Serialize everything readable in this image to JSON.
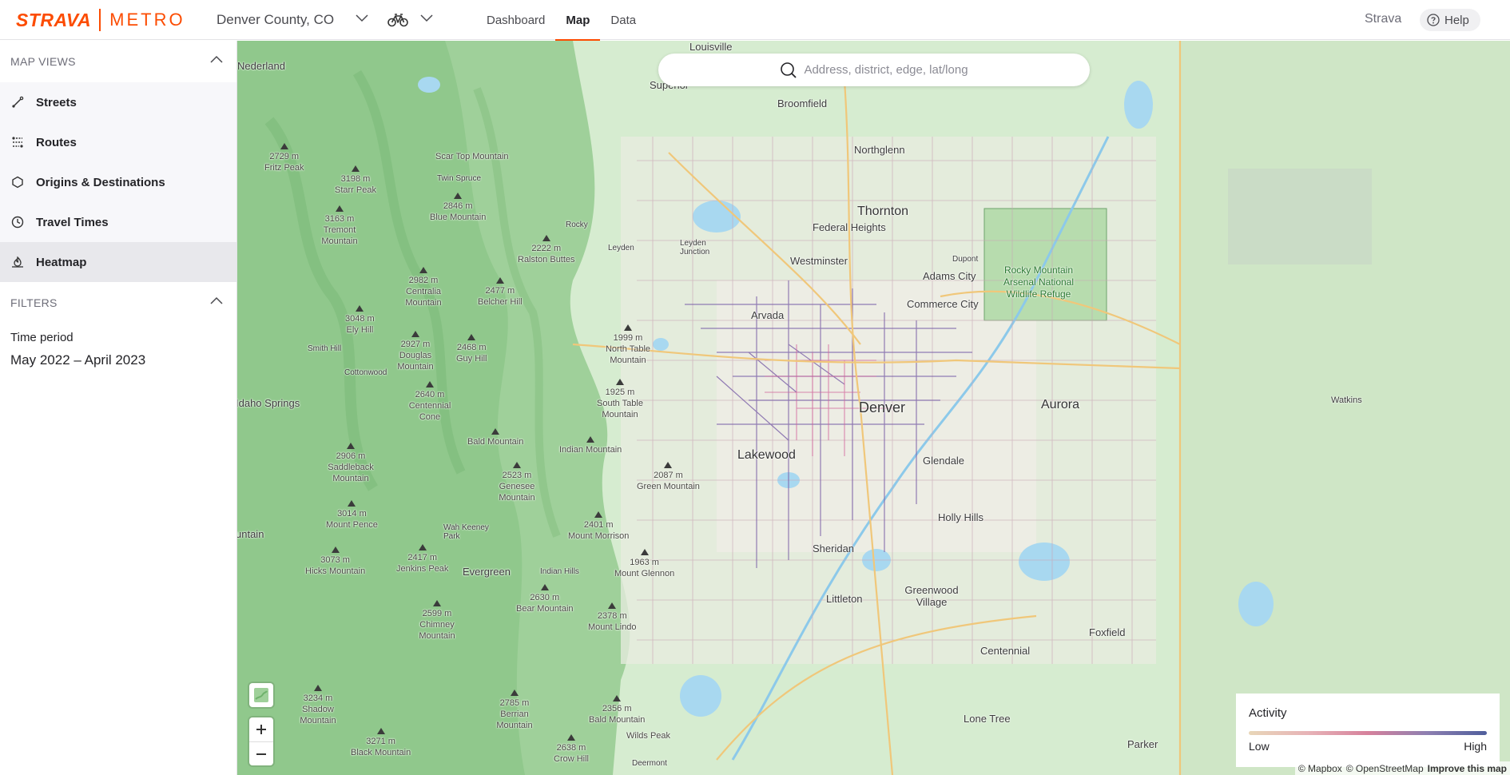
{
  "header": {
    "logo_brand": "STRAVA",
    "logo_product": "METRO",
    "region": "Denver County, CO",
    "sport_icon": "bicycle-icon",
    "tabs": [
      {
        "label": "Dashboard",
        "active": false
      },
      {
        "label": "Map",
        "active": true
      },
      {
        "label": "Data",
        "active": false
      }
    ],
    "strava_link": "Strava",
    "help_label": "Help"
  },
  "sidebar": {
    "map_views_heading": "MAP VIEWS",
    "views": [
      {
        "label": "Streets",
        "icon": "streets-icon",
        "active": false
      },
      {
        "label": "Routes",
        "icon": "routes-icon",
        "active": false
      },
      {
        "label": "Origins & Destinations",
        "icon": "hexagon-icon",
        "active": false
      },
      {
        "label": "Travel Times",
        "icon": "clock-icon",
        "active": false
      },
      {
        "label": "Heatmap",
        "icon": "heatmap-icon",
        "active": true
      }
    ],
    "filters_heading": "FILTERS",
    "time_period_label": "Time period",
    "time_period_value": "May 2022 – April 2023"
  },
  "map": {
    "search_placeholder": "Address, district, edge, lat/long",
    "places": {
      "louisville": "Louisville",
      "superior": "Superior",
      "broomfield": "Broomfield",
      "northglenn": "Northglenn",
      "thornton": "Thornton",
      "federal_heights": "Federal Heights",
      "westminster": "Westminster",
      "dupont": "Dupont",
      "adams_city": "Adams City",
      "commerce_city": "Commerce City",
      "arvada": "Arvada",
      "denver": "Denver",
      "aurora": "Aurora",
      "watkins": "Watkins",
      "lakewood": "Lakewood",
      "glendale": "Glendale",
      "holly_hills": "Holly Hills",
      "sheridan": "Sheridan",
      "greenwood_village": "Greenwood Village",
      "littleton": "Littleton",
      "foxfield": "Foxfield",
      "centennial": "Centennial",
      "lone_tree": "Lone Tree",
      "parker": "Parker",
      "evergreen": "Evergreen",
      "idaho_springs": "Idaho Springs",
      "nederland": "Nederland",
      "rocky": "Rocky",
      "leyden": "Leyden",
      "leyden_junction": "Leyden Junction",
      "twin_spruce": "Twin Spruce",
      "smith_hill": "Smith Hill",
      "cottonwood": "Cottonwood",
      "wah_keeney_park": "Wah Keeney Park",
      "indian_hills": "Indian Hills",
      "deermont": "Deermont",
      "untain": "untain",
      "rocky_mountain_arsenal": "Rocky Mountain Arsenal National Wildlife Refuge"
    },
    "peaks": [
      {
        "elev": "2729 m",
        "name": "Fritz Peak"
      },
      {
        "elev": "3198 m",
        "name": "Starr Peak"
      },
      {
        "elev": "",
        "name": "Scar Top Mountain"
      },
      {
        "elev": "2846 m",
        "name": "Blue Mountain"
      },
      {
        "elev": "3163 m",
        "name": "Tremont Mountain"
      },
      {
        "elev": "2222 m",
        "name": "Ralston Buttes"
      },
      {
        "elev": "2982 m",
        "name": "Centralia Mountain"
      },
      {
        "elev": "2477 m",
        "name": "Belcher Hill"
      },
      {
        "elev": "3048 m",
        "name": "Ely Hill"
      },
      {
        "elev": "1999 m",
        "name": "North Table Mountain"
      },
      {
        "elev": "2927 m",
        "name": "Douglas Mountain"
      },
      {
        "elev": "2468 m",
        "name": "Guy Hill"
      },
      {
        "elev": "1925 m",
        "name": "South Table Mountain"
      },
      {
        "elev": "2640 m",
        "name": "Centennial Cone"
      },
      {
        "elev": "",
        "name": "Bald Mountain"
      },
      {
        "elev": "",
        "name": "Indian Mountain"
      },
      {
        "elev": "2906 m",
        "name": "Saddleback Mountain"
      },
      {
        "elev": "2523 m",
        "name": "Genesee Mountain"
      },
      {
        "elev": "2087 m",
        "name": "Green Mountain"
      },
      {
        "elev": "3014 m",
        "name": "Mount Pence"
      },
      {
        "elev": "2401 m",
        "name": "Mount Morrison"
      },
      {
        "elev": "3073 m",
        "name": "Hicks Mountain"
      },
      {
        "elev": "2417 m",
        "name": "Jenkins Peak"
      },
      {
        "elev": "1963 m",
        "name": "Mount Glennon"
      },
      {
        "elev": "2630 m",
        "name": "Bear Mountain"
      },
      {
        "elev": "2599 m",
        "name": "Chimney Mountain"
      },
      {
        "elev": "2378 m",
        "name": "Mount Lindo"
      },
      {
        "elev": "3234 m",
        "name": "Shadow Mountain"
      },
      {
        "elev": "2785 m",
        "name": "Berrian Mountain"
      },
      {
        "elev": "2356 m",
        "name": "Bald Mountain"
      },
      {
        "elev": "3271 m",
        "name": "Black Mountain"
      },
      {
        "elev": "2638 m",
        "name": "Crow Hill"
      },
      {
        "elev": "",
        "name": "Wilds Peak"
      }
    ],
    "legend": {
      "title": "Activity",
      "low": "Low",
      "high": "High"
    },
    "attribution": {
      "mapbox": "© Mapbox",
      "osm": "© OpenStreetMap",
      "improve": "Improve this map"
    },
    "colors": {
      "accent": "#fc4c02",
      "land": "#cfe8c8",
      "mountains": "#9ccf98",
      "water": "#a8d8f0"
    }
  }
}
